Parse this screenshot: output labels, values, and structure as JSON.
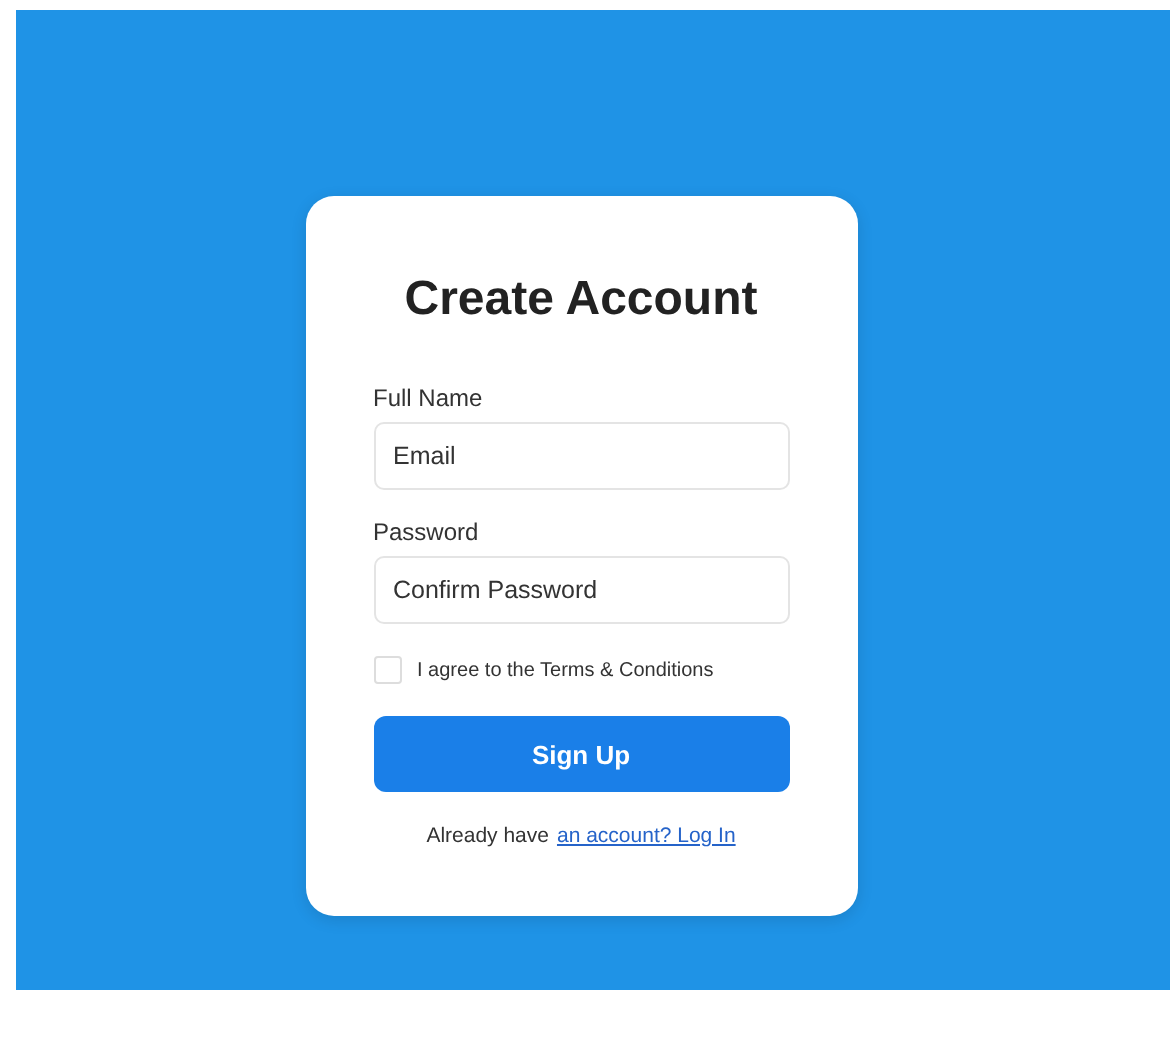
{
  "title": "Create Account",
  "fields": [
    {
      "label": "Full Name",
      "placeholder": "Email"
    },
    {
      "label": "Password",
      "placeholder": "Confirm Password"
    }
  ],
  "agree": {
    "label": "I agree to the Terms & Conditions",
    "checked": false
  },
  "submit": "Sign Up",
  "footer": {
    "text": "Already have",
    "link": "an account? Log In"
  }
}
